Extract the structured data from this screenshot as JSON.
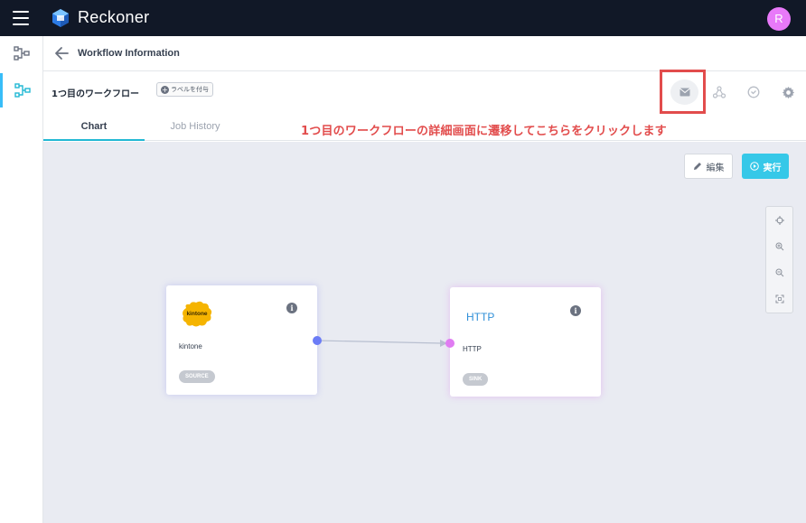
{
  "app": {
    "brand": "Reckoner",
    "avatar_initial": "R"
  },
  "subheader": {
    "title": "Workflow Information"
  },
  "workflow": {
    "name": "1つ目のワークフロー",
    "label_button": "ラベルを付与"
  },
  "tabs": [
    {
      "label": "Chart",
      "active": true
    },
    {
      "label": "Job History",
      "active": false
    }
  ],
  "toolbar": {
    "icons": [
      "mail-icon",
      "network-icon",
      "check-circle-icon",
      "gear-icon"
    ]
  },
  "annotation": {
    "text": "1つ目のワークフローの詳細画面に遷移してこちらをクリックします",
    "color": "#e24c4c"
  },
  "actions": {
    "edit_label": "編集",
    "run_label": "実行"
  },
  "zoom_controls": [
    "target-icon",
    "zoom-in-icon",
    "zoom-out-icon",
    "fit-icon"
  ],
  "nodes": {
    "source": {
      "logo_text": "kintone",
      "name": "kintone",
      "badge": "SOURCE"
    },
    "sink": {
      "logo_text": "HTTP",
      "name": "HTTP",
      "badge": "SINK"
    }
  },
  "colors": {
    "topbar": "#111827",
    "accent": "#22b8d4",
    "run_button": "#36c8e8",
    "avatar": "#e879f9",
    "canvas": "#e9ebf2"
  }
}
